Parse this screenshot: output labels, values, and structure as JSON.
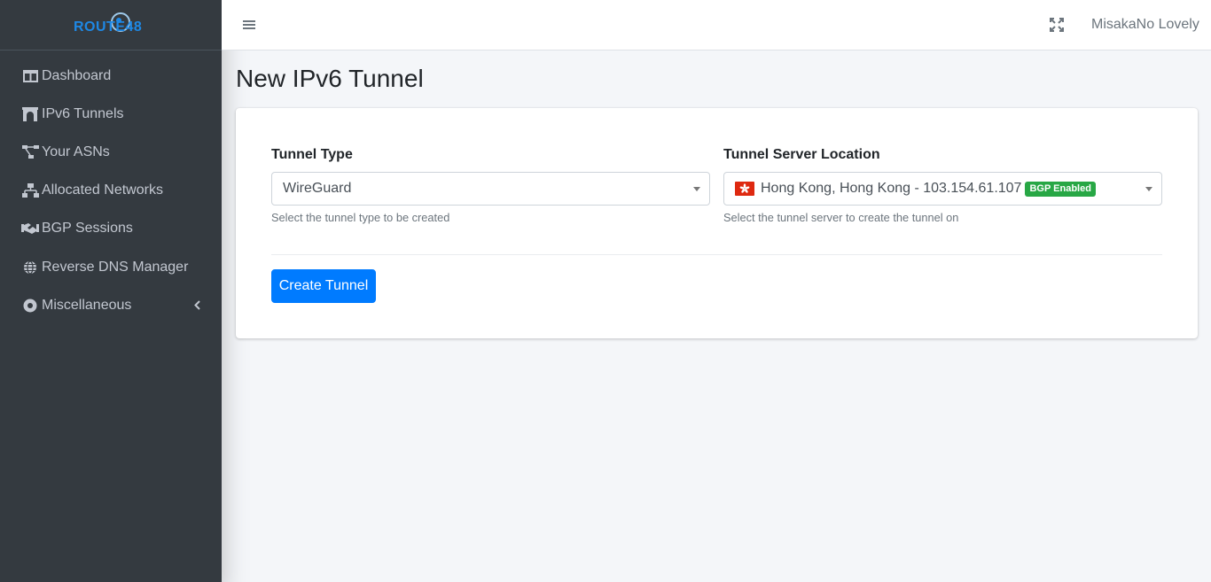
{
  "brand": {
    "logo_text": "ROUTE48"
  },
  "sidebar": {
    "items": [
      {
        "label": "Dashboard"
      },
      {
        "label": "IPv6 Tunnels"
      },
      {
        "label": "Your ASNs"
      },
      {
        "label": "Allocated Networks"
      },
      {
        "label": "BGP Sessions"
      },
      {
        "label": "Reverse DNS Manager"
      },
      {
        "label": "Miscellaneous"
      }
    ]
  },
  "header": {
    "user_name": "MisakaNo Lovely"
  },
  "page": {
    "title": "New IPv6 Tunnel"
  },
  "form": {
    "tunnel_type": {
      "label": "Tunnel Type",
      "value": "WireGuard",
      "help": "Select the tunnel type to be created"
    },
    "server_location": {
      "label": "Tunnel Server Location",
      "value": "Hong Kong, Hong Kong - 103.154.61.107",
      "badge": "BGP Enabled",
      "help": "Select the tunnel server to create the tunnel on"
    },
    "submit_label": "Create Tunnel"
  },
  "colors": {
    "sidebar_bg": "#343a40",
    "primary": "#007bff",
    "badge_success": "#28a745",
    "flag_red": "#de2910"
  }
}
